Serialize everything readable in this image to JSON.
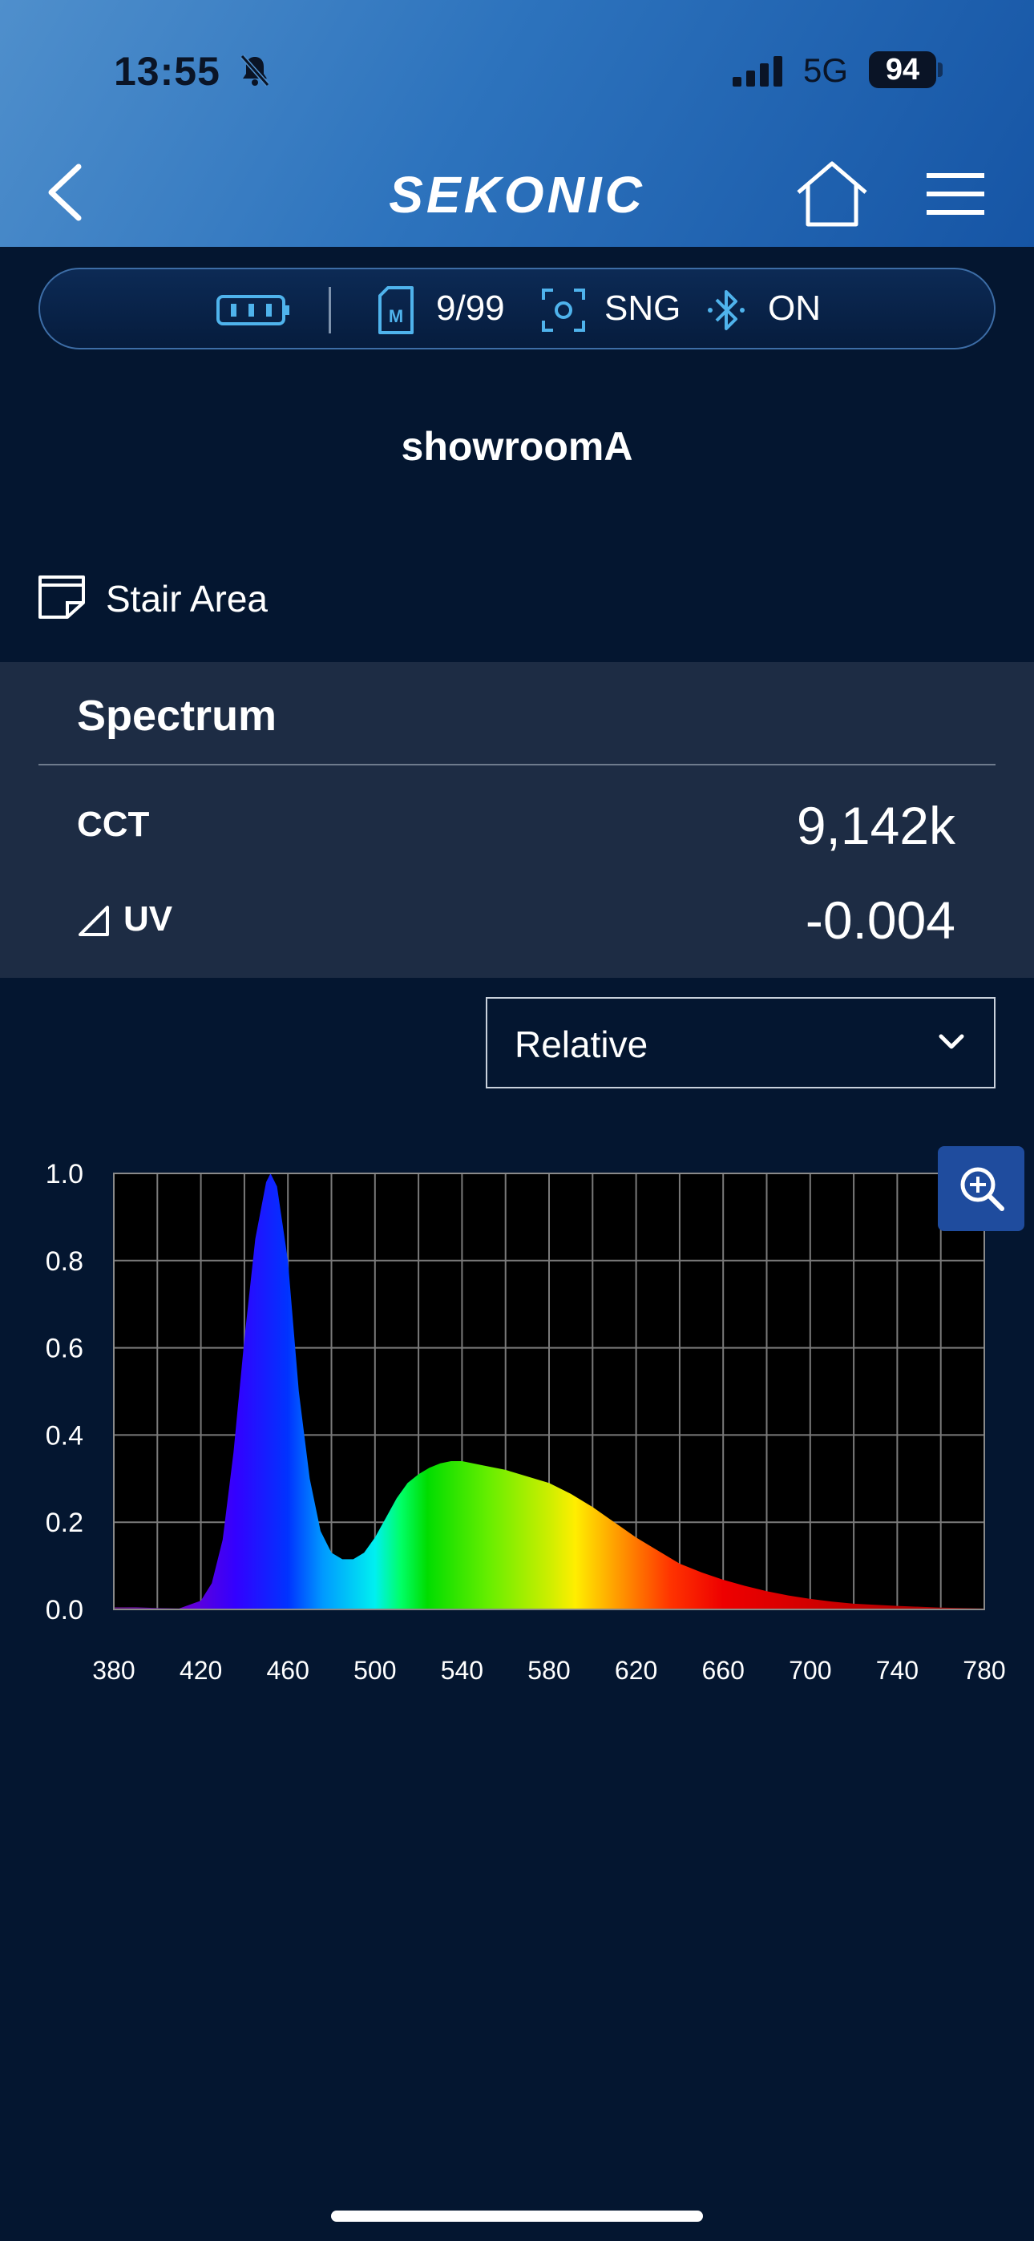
{
  "status_bar": {
    "time": "13:55",
    "network": "5G",
    "battery": "94"
  },
  "header": {
    "brand": "SEKONIC"
  },
  "device_bar": {
    "memory": "9/99",
    "mode": "SNG",
    "bluetooth": "ON"
  },
  "project": {
    "name": "showroomA"
  },
  "memo": {
    "label": "Stair Area"
  },
  "panel": {
    "title": "Spectrum",
    "cct_label": "CCT",
    "cct_value": "9,142k",
    "duv_label": "UV",
    "duv_value": "-0.004"
  },
  "dropdown": {
    "selected": "Relative"
  },
  "colors": {
    "accent": "#1f4c9e",
    "background": "#041630",
    "panel": "#1d2c44"
  },
  "chart_data": {
    "type": "area",
    "title": "",
    "xlabel": "",
    "ylabel": "",
    "xlim": [
      380,
      780
    ],
    "ylim": [
      0,
      1.0
    ],
    "x_ticks": [
      380,
      420,
      460,
      500,
      540,
      580,
      620,
      660,
      700,
      740,
      780
    ],
    "y_ticks": [
      "0.0",
      "0.2",
      "0.4",
      "0.6",
      "0.8",
      "1.0"
    ],
    "grid": true,
    "series": [
      {
        "x": [
          380,
          390,
          400,
          410,
          420,
          425,
          430,
          435,
          440,
          445,
          450,
          452,
          455,
          460,
          465,
          470,
          475,
          480,
          485,
          490,
          495,
          500,
          505,
          510,
          515,
          520,
          525,
          530,
          535,
          540,
          545,
          550,
          560,
          570,
          580,
          590,
          600,
          610,
          620,
          630,
          640,
          650,
          660,
          670,
          680,
          690,
          700,
          710,
          720,
          740,
          760,
          780
        ],
        "y": [
          0.005,
          0.005,
          0.003,
          0.002,
          0.02,
          0.06,
          0.16,
          0.36,
          0.62,
          0.85,
          0.98,
          1.0,
          0.97,
          0.8,
          0.5,
          0.3,
          0.18,
          0.13,
          0.115,
          0.115,
          0.13,
          0.165,
          0.21,
          0.255,
          0.29,
          0.31,
          0.325,
          0.335,
          0.34,
          0.34,
          0.335,
          0.33,
          0.32,
          0.305,
          0.29,
          0.265,
          0.235,
          0.2,
          0.165,
          0.135,
          0.105,
          0.085,
          0.068,
          0.054,
          0.042,
          0.032,
          0.024,
          0.018,
          0.013,
          0.008,
          0.004,
          0.002
        ]
      }
    ]
  }
}
